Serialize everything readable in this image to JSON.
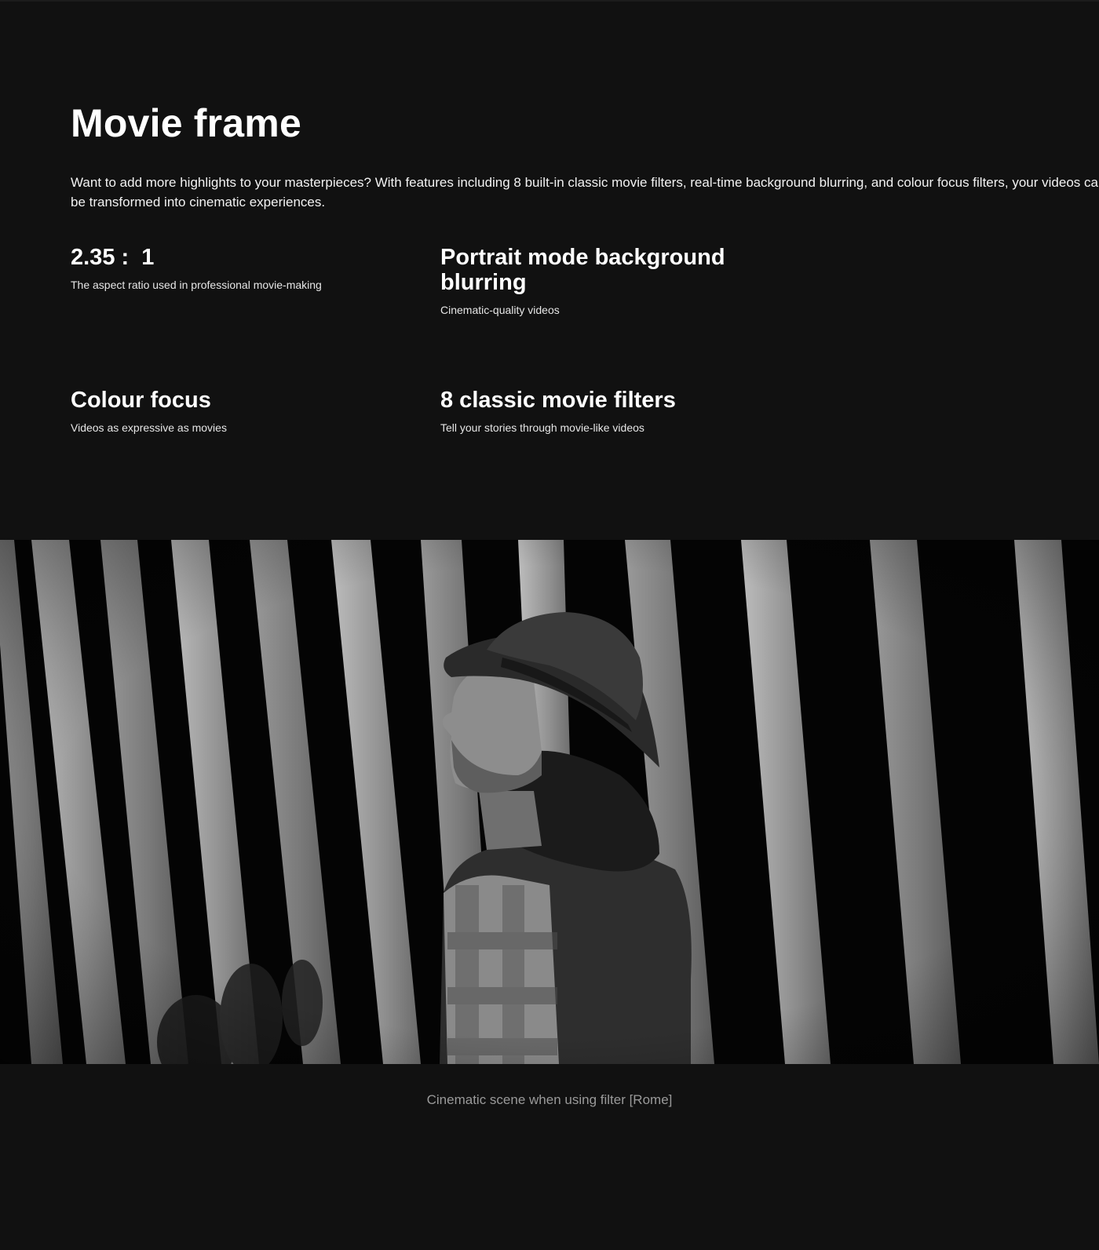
{
  "section": {
    "title": "Movie frame",
    "intro": "Want to add more highlights to your masterpieces? With features including 8 built-in classic movie filters, real-time background blurring, and colour focus filters, your videos can be transformed into cinematic experiences."
  },
  "features": [
    {
      "heading": "2.35 :  1",
      "description": "The aspect ratio used in professional movie-making"
    },
    {
      "heading": "Portrait mode background blurring",
      "description": "Cinematic-quality videos"
    },
    {
      "heading": "Colour focus",
      "description": "Videos as expressive as movies"
    },
    {
      "heading": "8 classic movie filters",
      "description": "Tell your stories through movie-like videos"
    }
  ],
  "image": {
    "caption": "Cinematic scene when using filter [Rome]"
  }
}
